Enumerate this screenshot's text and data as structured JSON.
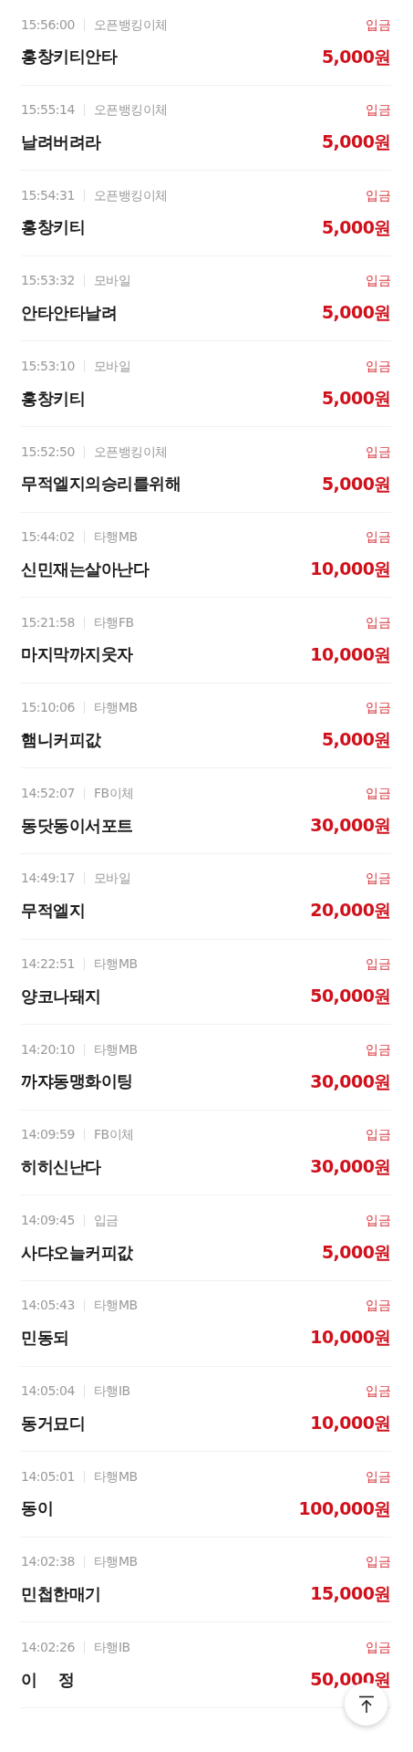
{
  "transactions": [
    {
      "time": "15:56:00",
      "method": "오픈뱅킹이체",
      "type": "입금",
      "name": "홍창키티안타",
      "amount": "5,000원"
    },
    {
      "time": "15:55:14",
      "method": "오픈뱅킹이체",
      "type": "입금",
      "name": "날려버려라",
      "amount": "5,000원"
    },
    {
      "time": "15:54:31",
      "method": "오픈뱅킹이체",
      "type": "입금",
      "name": "홍창키티",
      "amount": "5,000원"
    },
    {
      "time": "15:53:32",
      "method": "모바일",
      "type": "입금",
      "name": "안타안타날려",
      "amount": "5,000원"
    },
    {
      "time": "15:53:10",
      "method": "모바일",
      "type": "입금",
      "name": "홍창키티",
      "amount": "5,000원"
    },
    {
      "time": "15:52:50",
      "method": "오픈뱅킹이체",
      "type": "입금",
      "name": "무적엘지의승리를위해",
      "amount": "5,000원"
    },
    {
      "time": "15:44:02",
      "method": "타행MB",
      "type": "입금",
      "name": "신민재는살아난다",
      "amount": "10,000원"
    },
    {
      "time": "15:21:58",
      "method": "타행FB",
      "type": "입금",
      "name": "마지막까지웃자",
      "amount": "10,000원"
    },
    {
      "time": "15:10:06",
      "method": "타행MB",
      "type": "입금",
      "name": "햄니커피값",
      "amount": "5,000원"
    },
    {
      "time": "14:52:07",
      "method": "FB이체",
      "type": "입금",
      "name": "동닷동이서포트",
      "amount": "30,000원"
    },
    {
      "time": "14:49:17",
      "method": "모바일",
      "type": "입금",
      "name": "무적엘지",
      "amount": "20,000원"
    },
    {
      "time": "14:22:51",
      "method": "타행MB",
      "type": "입금",
      "name": "양코나돼지",
      "amount": "50,000원"
    },
    {
      "time": "14:20:10",
      "method": "타행MB",
      "type": "입금",
      "name": "까쟈동맹화이팅",
      "amount": "30,000원"
    },
    {
      "time": "14:09:59",
      "method": "FB이체",
      "type": "입금",
      "name": "히히신난다",
      "amount": "30,000원"
    },
    {
      "time": "14:09:45",
      "method": "입금",
      "type": "입금",
      "name": "사댜오늘커피값",
      "amount": "5,000원"
    },
    {
      "time": "14:05:43",
      "method": "타행MB",
      "type": "입금",
      "name": "민동되",
      "amount": "10,000원"
    },
    {
      "time": "14:05:04",
      "method": "타행IB",
      "type": "입금",
      "name": "동거묘디",
      "amount": "10,000원"
    },
    {
      "time": "14:05:01",
      "method": "타행MB",
      "type": "입금",
      "name": "동이",
      "amount": "100,000원"
    },
    {
      "time": "14:02:38",
      "method": "타행MB",
      "type": "입금",
      "name": "민첩한매기",
      "amount": "15,000원"
    },
    {
      "time": "14:02:26",
      "method": "타행IB",
      "type": "입금",
      "name": "이    정",
      "amount": "50,000원"
    }
  ]
}
